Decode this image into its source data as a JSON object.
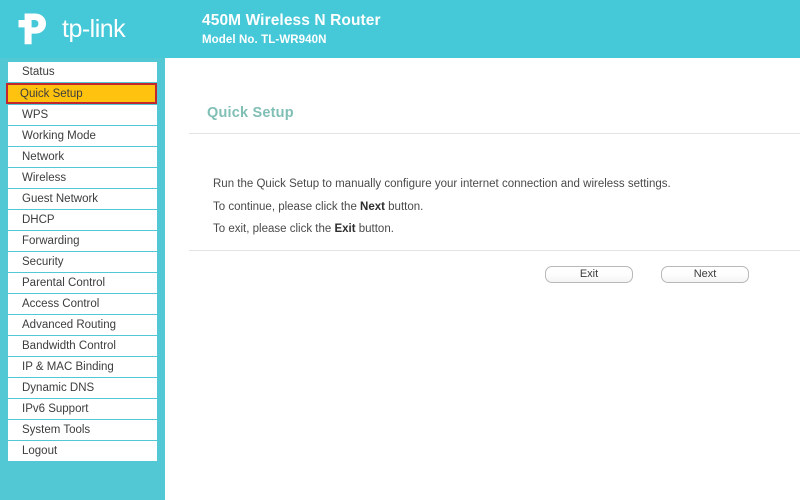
{
  "header": {
    "brand": "tp-link",
    "logo_icon": "tplink-logo-icon",
    "title": "450M Wireless N Router",
    "subtitle": "Model No. TL-WR940N",
    "background_color": "#45c8d8"
  },
  "sidebar": {
    "background_color": "#52c8d5",
    "active_item_bg": "#ffc20e",
    "active_item_border": "#c1272d",
    "items": [
      {
        "label": "Status",
        "active": false
      },
      {
        "label": "Quick Setup",
        "active": true
      },
      {
        "label": "WPS",
        "active": false
      },
      {
        "label": "Working Mode",
        "active": false
      },
      {
        "label": "Network",
        "active": false
      },
      {
        "label": "Wireless",
        "active": false
      },
      {
        "label": "Guest Network",
        "active": false
      },
      {
        "label": "DHCP",
        "active": false
      },
      {
        "label": "Forwarding",
        "active": false
      },
      {
        "label": "Security",
        "active": false
      },
      {
        "label": "Parental Control",
        "active": false
      },
      {
        "label": "Access Control",
        "active": false
      },
      {
        "label": "Advanced Routing",
        "active": false
      },
      {
        "label": "Bandwidth Control",
        "active": false
      },
      {
        "label": "IP & MAC Binding",
        "active": false
      },
      {
        "label": "Dynamic DNS",
        "active": false
      },
      {
        "label": "IPv6 Support",
        "active": false
      },
      {
        "label": "System Tools",
        "active": false
      },
      {
        "label": "Logout",
        "active": false
      }
    ]
  },
  "main": {
    "page_title": "Quick Setup",
    "page_title_color": "#7fbfb5",
    "paragraphs": {
      "line1": "Run the Quick Setup to manually configure your internet connection and wireless settings.",
      "line2_pre": "To continue, please click the ",
      "line2_strong": "Next",
      "line2_post": " button.",
      "line3_pre": "To exit, please click the ",
      "line3_strong": "Exit",
      "line3_post": "  button."
    },
    "buttons": {
      "exit_label": "Exit",
      "next_label": "Next"
    }
  }
}
